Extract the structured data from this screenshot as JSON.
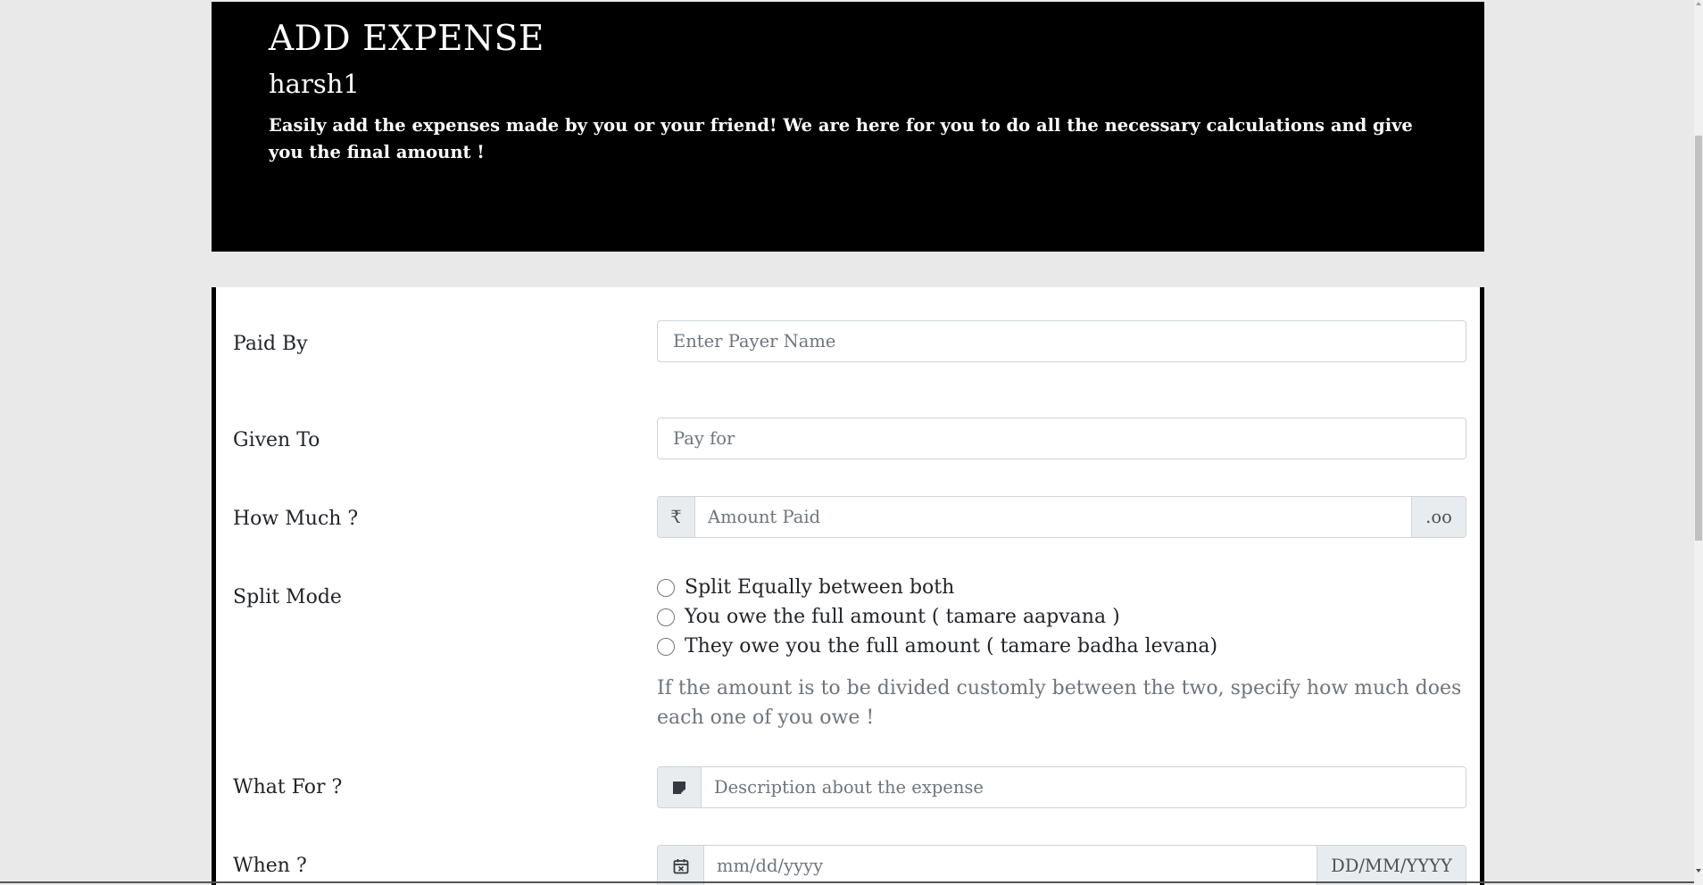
{
  "header": {
    "title": "ADD EXPENSE",
    "username": "harsh1",
    "description": "Easily add the expenses made by you or your friend! We are here for you to do all the necessary calculations and give you the final amount !"
  },
  "form": {
    "paid_by": {
      "label": "Paid By",
      "placeholder": "Enter Payer Name"
    },
    "given_to": {
      "label": "Given To",
      "placeholder": "Pay for"
    },
    "how_much": {
      "label": "How Much ?",
      "prefix": "₹",
      "placeholder": "Amount Paid",
      "suffix": ".oo"
    },
    "split_mode": {
      "label": "Split Mode",
      "options": [
        "Split Equally between both",
        "You owe the full amount ( tamare aapvana )",
        "They owe you the full amount ( tamare badha levana)"
      ],
      "help": "If the amount is to be divided customly between the two, specify how much does each one of you owe !"
    },
    "what_for": {
      "label": "What For ?",
      "icon": "sticky-note-icon",
      "placeholder": "Description about the expense"
    },
    "when": {
      "label": "When ?",
      "icon": "calendar-icon",
      "placeholder": "mm/dd/yyyy",
      "suffix": "DD/MM/YYYY"
    }
  },
  "colors": {
    "header_bg": "#000000",
    "page_bg": "#e9e9e9",
    "addon_bg": "#e9ecef"
  }
}
